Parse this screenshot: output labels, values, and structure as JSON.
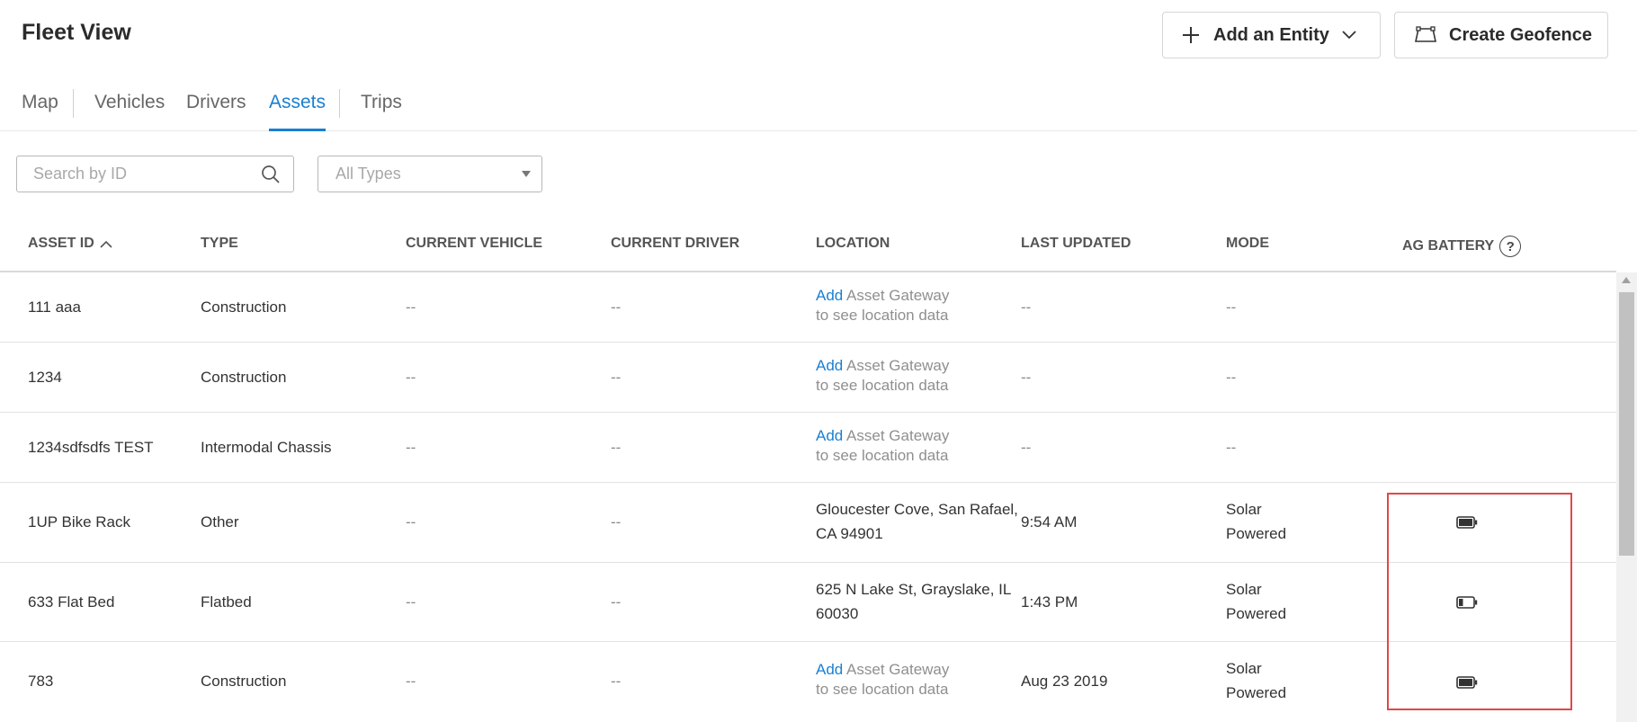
{
  "page": {
    "title": "Fleet View"
  },
  "header_buttons": {
    "add_entity": "Add an Entity",
    "create_geofence": "Create Geofence"
  },
  "tabs": [
    {
      "label": "Map",
      "active": false
    },
    {
      "label": "Vehicles",
      "active": false
    },
    {
      "label": "Drivers",
      "active": false
    },
    {
      "label": "Assets",
      "active": true
    },
    {
      "label": "Trips",
      "active": false
    }
  ],
  "filters": {
    "search_placeholder": "Search by ID",
    "type_select_value": "All Types"
  },
  "table": {
    "columns": [
      "ASSET ID",
      "TYPE",
      "CURRENT VEHICLE",
      "CURRENT DRIVER",
      "LOCATION",
      "LAST UPDATED",
      "MODE",
      "AG BATTERY"
    ],
    "sort": {
      "column": "ASSET ID",
      "direction": "ascending"
    },
    "location_hint": {
      "link": "Add",
      "text1": "Asset Gateway",
      "text2": "to see location data"
    },
    "rows": [
      {
        "asset_id": "111 aaa",
        "type": "Construction",
        "vehicle": "--",
        "driver": "--",
        "location": null,
        "last_updated": "--",
        "mode": "--",
        "battery": null
      },
      {
        "asset_id": "1234",
        "type": "Construction",
        "vehicle": "--",
        "driver": "--",
        "location": null,
        "last_updated": "--",
        "mode": "--",
        "battery": null
      },
      {
        "asset_id": "1234sdfsdfs TEST",
        "type": "Intermodal Chassis",
        "vehicle": "--",
        "driver": "--",
        "location": null,
        "last_updated": "--",
        "mode": "--",
        "battery": null
      },
      {
        "asset_id": "1UP Bike Rack",
        "type": "Other",
        "vehicle": "--",
        "driver": "--",
        "location": "Gloucester Cove, San Rafael, CA 94901",
        "last_updated": "9:54 AM",
        "mode": "Solar Powered",
        "battery": {
          "level": 1.0,
          "icon": "battery-full-icon"
        }
      },
      {
        "asset_id": "633 Flat Bed",
        "type": "Flatbed",
        "vehicle": "--",
        "driver": "--",
        "location": "625 N Lake St, Grayslake, IL 60030",
        "last_updated": "1:43 PM",
        "mode": "Solar Powered",
        "battery": {
          "level": 0.3,
          "icon": "battery-low-icon"
        }
      },
      {
        "asset_id": "783",
        "type": "Construction",
        "vehicle": "--",
        "driver": "--",
        "location": null,
        "last_updated": "Aug 23 2019",
        "mode": "Solar Powered",
        "battery": {
          "level": 1.0,
          "icon": "battery-full-icon"
        }
      }
    ]
  },
  "colors": {
    "accent": "#1a7fd1",
    "highlight": "#e04848"
  }
}
